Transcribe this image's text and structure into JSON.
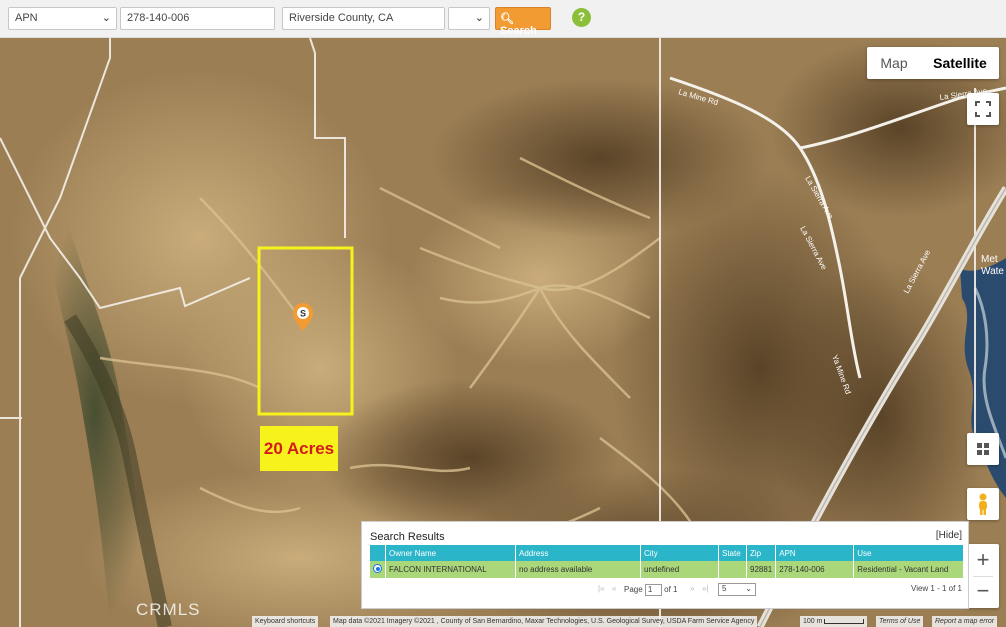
{
  "search": {
    "type_value": "APN",
    "query_value": "278-140-006",
    "county_value": "Riverside County, CA",
    "extra_value": "",
    "button_label": "Search",
    "help_label": "?"
  },
  "map": {
    "map_type_options": [
      "Map",
      "Satellite"
    ],
    "selected_map_type": "Satellite",
    "marker_label": "S",
    "area_label": "20 Acres",
    "road_labels": [
      "La Mine Rd",
      "La Sierra Ave",
      "La Sierra Ave",
      "La Sierra Ave",
      "Ya Mine Rd",
      "La Sierra Ave"
    ],
    "water_label": "Met\nWate",
    "watermark": "CRMLS",
    "attribution": {
      "shortcuts": "Keyboard shortcuts",
      "data": "Map data ©2021 Imagery ©2021 , County of San Bernardino, Maxar Technologies, U.S. Geological Survey, USDA Farm Service Agency",
      "scale": "100 m",
      "terms": "Terms of Use",
      "report": "Report a map error"
    },
    "colors": {
      "terrain": "#9c7f55",
      "outline": "#f7f21c",
      "marker": "#f29b33"
    }
  },
  "results": {
    "title": "Search Results",
    "hide_label": "[Hide]",
    "columns": [
      "Owner Name",
      "Address",
      "City",
      "State",
      "Zip",
      "APN",
      "Use"
    ],
    "rows": [
      [
        "FALCON INTERNATIONAL",
        "no address available",
        "undefined",
        "",
        "92881",
        "278-140-006",
        "Residential - Vacant Land"
      ]
    ],
    "pager": {
      "page_label": "Page",
      "page_value": "1",
      "of_label": "of 1",
      "per_page": "5",
      "view_text": "View 1 - 1 of 1"
    }
  }
}
